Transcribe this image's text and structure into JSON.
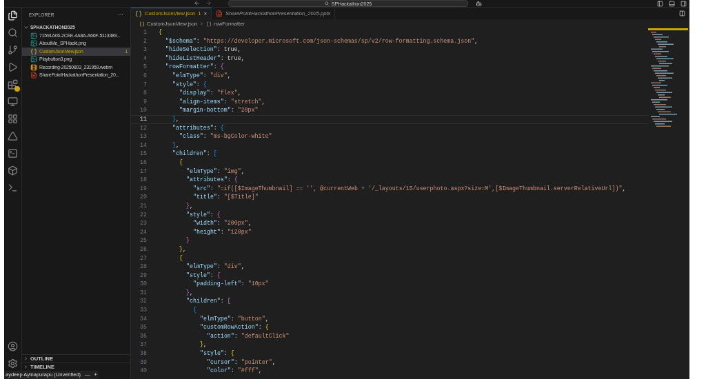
{
  "title_bar": {
    "search": "SPHackathon2025"
  },
  "explorer": {
    "title": "EXPLORER",
    "more": "···",
    "folder": {
      "name": "SPHACKATHON2025",
      "expanded": true,
      "files": [
        {
          "name": "71591A06-2CEE-4A8A-A66F-5113389...",
          "kind": "image",
          "selected": false
        },
        {
          "name": "AboutMe_SPHackl.png",
          "kind": "image",
          "selected": false
        },
        {
          "name": "CustomJsonView.json",
          "kind": "json",
          "selected": true,
          "badge": "1"
        },
        {
          "name": "Playbutton3.png",
          "kind": "image",
          "selected": false
        },
        {
          "name": "Recording-20250803_231959.webm",
          "kind": "video",
          "selected": false
        },
        {
          "name": "SharePointHackathonPresentation_20...",
          "kind": "slides",
          "selected": false
        }
      ]
    },
    "sections": [
      {
        "name": "OUTLINE",
        "expanded": false
      },
      {
        "name": "TIMELINE",
        "expanded": false
      }
    ]
  },
  "tabs": [
    {
      "label": "CustomJsonView.json",
      "badge": "1",
      "kind": "json",
      "selected": true,
      "preview": false,
      "close": "×"
    },
    {
      "label": "SharePointHackathonPresentation_2025.pptx",
      "kind": "slides",
      "selected": false,
      "preview": true
    }
  ],
  "breadcrumb": [
    "CustomJsonView.json",
    "rowFormatter"
  ],
  "code": [
    {
      "n": "1",
      "current": false,
      "text": "{"
    },
    {
      "n": "2",
      "current": false,
      "text": "\"$schema\": \"https://developer.microsoft.com/json-schemas/sp/v2/row-formatting.schema.json\","
    },
    {
      "n": "3",
      "current": false,
      "text": "\"hideSelection\": true,"
    },
    {
      "n": "4",
      "current": false,
      "text": "\"hideListHeader\": true,"
    },
    {
      "n": "5",
      "current": false,
      "text": "\"rowFormatter\": {"
    },
    {
      "n": "6",
      "current": false,
      "text": "\"elmType\": \"div\","
    },
    {
      "n": "7",
      "current": false,
      "text": "\"style\": {"
    },
    {
      "n": "8",
      "current": false,
      "text": "\"display\": \"flex\","
    },
    {
      "n": "9",
      "current": false,
      "text": "\"align-items\": \"stretch\","
    },
    {
      "n": "10",
      "current": false,
      "text": "\"margin-bottom\": \"20px\""
    },
    {
      "n": "11",
      "current": true,
      "text": "},"
    },
    {
      "n": "12",
      "current": false,
      "text": "\"attributes\": {"
    },
    {
      "n": "13",
      "current": false,
      "text": "\"class\": \"ms-bgColor-white\""
    },
    {
      "n": "14",
      "current": false,
      "text": "},"
    },
    {
      "n": "15",
      "current": false,
      "text": "\"children\": ["
    },
    {
      "n": "16",
      "current": false,
      "text": "{"
    },
    {
      "n": "17",
      "current": false,
      "text": "\"elmType\": \"img\","
    },
    {
      "n": "18",
      "current": false,
      "text": "\"attributes\": {"
    },
    {
      "n": "19",
      "current": false,
      "text": "\"src\": \"=if([$ImageThumbnail] == '', @currentWeb + '/_layouts/15/userphoto.aspx?size=M',[$ImageThumbnail.serverRelativeUrl])\","
    },
    {
      "n": "20",
      "current": false,
      "text": "\"title\": \"[$Title]\""
    },
    {
      "n": "21",
      "current": false,
      "text": "},"
    },
    {
      "n": "22",
      "current": false,
      "text": "\"style\": {"
    },
    {
      "n": "23",
      "current": false,
      "text": "\"width\": \"200px\","
    },
    {
      "n": "24",
      "current": false,
      "text": "\"height\": \"120px\""
    },
    {
      "n": "25",
      "current": false,
      "text": "}"
    },
    {
      "n": "26",
      "current": false,
      "text": "},"
    },
    {
      "n": "27",
      "current": false,
      "text": "{"
    },
    {
      "n": "28",
      "current": false,
      "text": "\"elmType\": \"div\","
    },
    {
      "n": "29",
      "current": false,
      "text": "\"style\": {"
    },
    {
      "n": "30",
      "current": false,
      "text": "\"padding-left\": \"10px\""
    },
    {
      "n": "31",
      "current": false,
      "text": "},"
    },
    {
      "n": "32",
      "current": false,
      "text": "\"children\": ["
    },
    {
      "n": "33",
      "current": false,
      "text": "{"
    },
    {
      "n": "34",
      "current": false,
      "text": "\"elmType\": \"button\","
    },
    {
      "n": "35",
      "current": false,
      "text": "\"customRowAction\": {"
    },
    {
      "n": "36",
      "current": false,
      "text": "\"action\": \"defaultClick\""
    },
    {
      "n": "37",
      "current": false,
      "text": "},"
    },
    {
      "n": "38",
      "current": false,
      "text": "\"style\": {"
    },
    {
      "n": "39",
      "current": false,
      "text": "\"cursor\": \"pointer\","
    },
    {
      "n": "40",
      "current": false,
      "text": "\"color\": \"#fff\","
    }
  ],
  "name_tag": {
    "name": "aydeep Ayinapurapu (Unverified)",
    "minus": "—",
    "plus": "+"
  }
}
